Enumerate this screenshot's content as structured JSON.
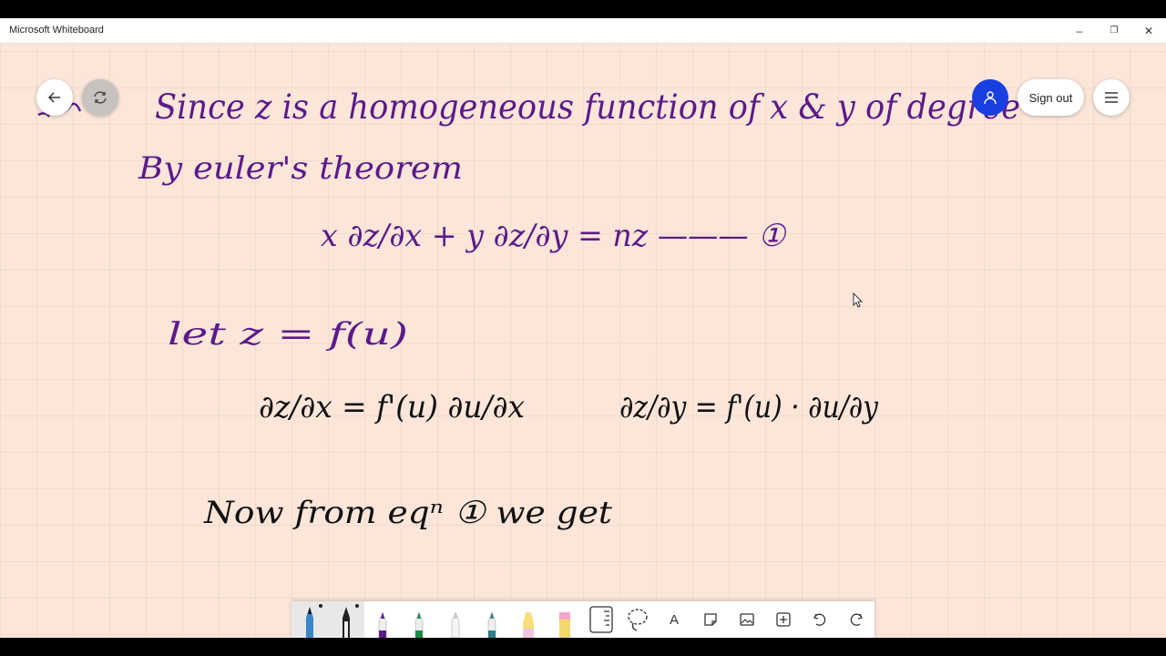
{
  "window": {
    "title": "Microsoft Whiteboard",
    "minimize_glyph": "–",
    "restore_glyph": "❐",
    "close_glyph": "✕"
  },
  "header": {
    "sign_out_label": "Sign out"
  },
  "whiteboard": {
    "ink_lines": [
      "Since z is a homogeneous function of x & y of degree",
      "By euler's theorem",
      "x ∂z/∂x + y ∂z/∂y = nz ——— ①",
      "let   z = f(u)",
      "∂z/∂x = f'(u) ∂u/∂x",
      "∂z/∂y = f'(u) · ∂u/∂y",
      "Now from eqⁿ ① we get"
    ]
  },
  "colors": {
    "canvas": "#fbe6d9",
    "ink_purple": "#5b1a8a",
    "ink_black": "#111111",
    "avatar_blue": "#1a3fe0"
  },
  "toolbar": {
    "tools": [
      "pen-black",
      "pen-black-2",
      "pen-purple",
      "pen-green",
      "pen-white",
      "pen-teal",
      "highlighter-yellow",
      "highlighter-pink",
      "ruler",
      "lasso",
      "text",
      "sticky-note",
      "image",
      "insert",
      "undo",
      "redo"
    ],
    "text_tool_glyph": "A"
  }
}
